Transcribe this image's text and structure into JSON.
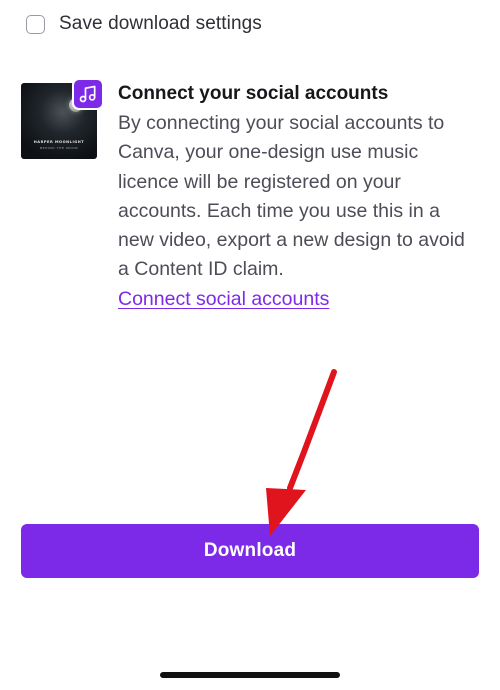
{
  "save_settings": {
    "label": "Save download settings",
    "checked": false
  },
  "social": {
    "thumbnail": {
      "title": "HARPER MOONLIGHT",
      "subtitle": "BEHIND THE MOON"
    },
    "badge_icon": "music-note-icon",
    "heading": "Connect your social accounts",
    "description": "By connecting your social accounts to Canva, your one-design use music licence will be registered on your accounts. Each time you use this in a new video, export a new design to avoid a Content ID claim.",
    "link_label": "Connect social accounts"
  },
  "download": {
    "label": "Download"
  },
  "colors": {
    "accent": "#7d2ae8",
    "annotation_arrow": "#e0141c"
  }
}
